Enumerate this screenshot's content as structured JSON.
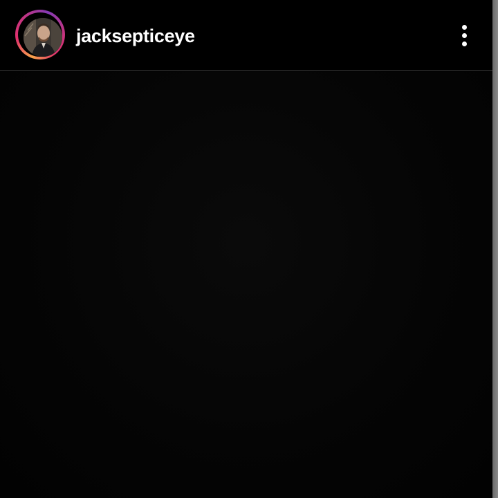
{
  "post": {
    "username": "jacksepticeye",
    "avatar_ring_colors": [
      "#f7a34b",
      "#e1306c",
      "#c13584",
      "#833ab4"
    ],
    "menu_icon": "more-vertical-icon",
    "media_background": "#050505"
  }
}
